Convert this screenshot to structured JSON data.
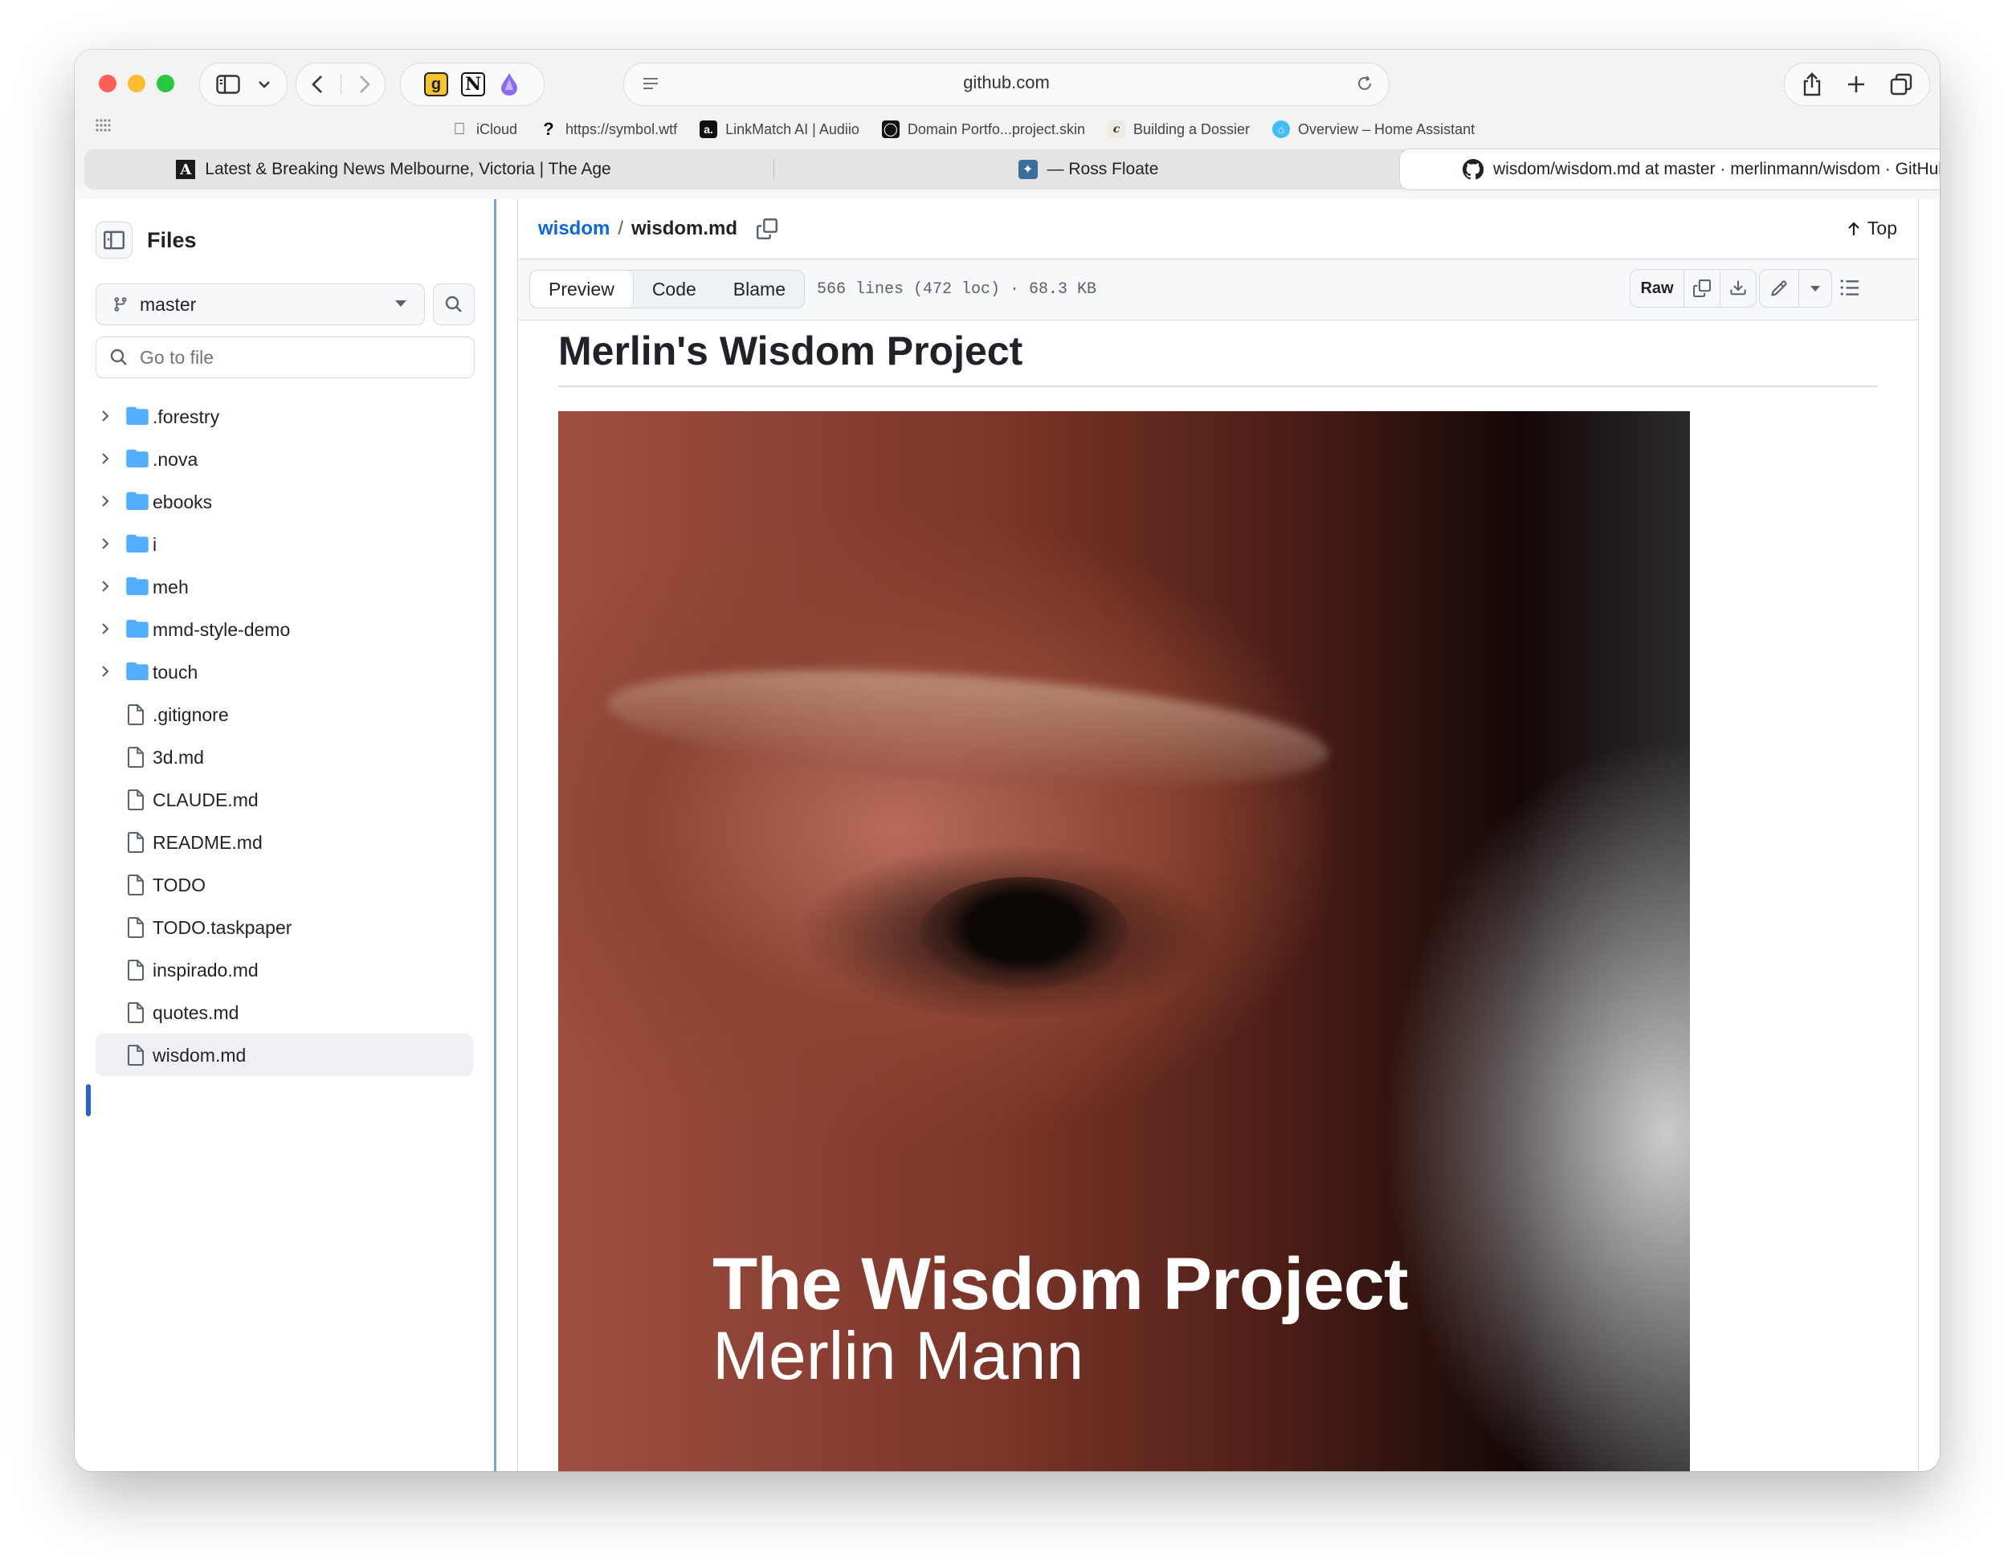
{
  "browser": {
    "address": "github.com",
    "bookmarks": [
      {
        "label": "iCloud",
        "icon": "apple-icon"
      },
      {
        "label": "https://symbol.wtf",
        "icon": "question-icon"
      },
      {
        "label": "LinkMatch AI | Audiio",
        "icon": "audiio-icon"
      },
      {
        "label": "Domain Portfo...project.skin",
        "icon": "spiral-icon"
      },
      {
        "label": "Building a Dossier",
        "icon": "c-icon"
      },
      {
        "label": "Overview – Home Assistant",
        "icon": "home-assistant-icon"
      }
    ],
    "tabs": [
      {
        "label": "Latest & Breaking News Melbourne, Victoria | The Age",
        "icon": "the-age-icon"
      },
      {
        "label": "— Ross Floate",
        "icon": "bird-icon"
      },
      {
        "label": "wisdom/wisdom.md at master · merlinmann/wisdom · GitHub",
        "icon": "github-icon"
      }
    ]
  },
  "sidebar": {
    "title": "Files",
    "branch": "master",
    "goto_placeholder": "Go to file",
    "items": [
      {
        "label": ".forestry",
        "type": "folder"
      },
      {
        "label": ".nova",
        "type": "folder"
      },
      {
        "label": "ebooks",
        "type": "folder"
      },
      {
        "label": "i",
        "type": "folder"
      },
      {
        "label": "meh",
        "type": "folder"
      },
      {
        "label": "mmd-style-demo",
        "type": "folder"
      },
      {
        "label": "touch",
        "type": "folder"
      },
      {
        "label": ".gitignore",
        "type": "file"
      },
      {
        "label": "3d.md",
        "type": "file"
      },
      {
        "label": "CLAUDE.md",
        "type": "file"
      },
      {
        "label": "README.md",
        "type": "file"
      },
      {
        "label": "TODO",
        "type": "file"
      },
      {
        "label": "TODO.taskpaper",
        "type": "file"
      },
      {
        "label": "inspirado.md",
        "type": "file"
      },
      {
        "label": "quotes.md",
        "type": "file"
      },
      {
        "label": "wisdom.md",
        "type": "file",
        "selected": true
      }
    ]
  },
  "main": {
    "breadcrumb_repo": "wisdom",
    "breadcrumb_sep": "/",
    "breadcrumb_file": "wisdom.md",
    "top_label": "Top",
    "tabs": [
      "Preview",
      "Code",
      "Blame"
    ],
    "file_meta": "566 lines (472 loc) · 68.3 KB",
    "raw_label": "Raw",
    "heading": "Merlin's Wisdom Project",
    "hero_title": "The Wisdom Project",
    "hero_author": "Merlin Mann"
  },
  "colors": {
    "link": "#0969da",
    "selected_marker": "#2c5fd6",
    "folder": "#54aeff"
  }
}
